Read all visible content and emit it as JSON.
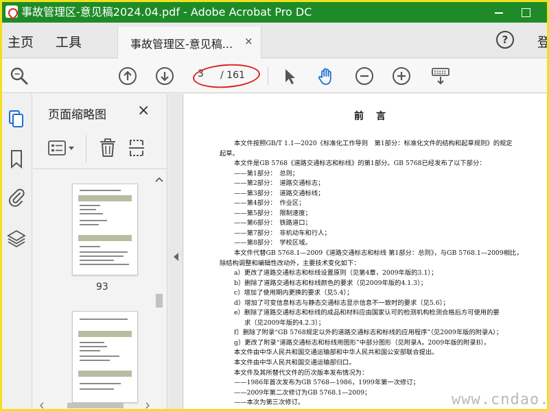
{
  "window": {
    "title": "事故管理区-意见稿2024.04.pdf - Adobe Acrobat Pro DC",
    "minimize_label": "",
    "maximize_label": ""
  },
  "menu": {
    "home": "主页",
    "tools": "工具",
    "tab_label": "事故管理区-意见稿...",
    "tab_close": "×",
    "help": "?",
    "login": "登"
  },
  "toolbar": {
    "current_page": "3",
    "total_pages": "/ 161"
  },
  "panel": {
    "title": "页面缩略图",
    "close": "×",
    "thumbnails": [
      {
        "label": "93"
      }
    ]
  },
  "document": {
    "heading": "前言",
    "lines": [
      {
        "cls": "i1",
        "text": "本文件按照GB/T 1.1—2020《标准化工作导则　第1部分：标准化文件的结构和起草规则》的规定"
      },
      {
        "cls": "",
        "text": "起草。"
      },
      {
        "cls": "i1",
        "text": "本文件是GB 5768《道路交通标志和标线》的第1部分。GB 5768已经发布了以下部分："
      },
      {
        "cls": "i2",
        "text": "——第1部分：　总则；"
      },
      {
        "cls": "i2",
        "text": "——第2部分：　道路交通标志；"
      },
      {
        "cls": "i2",
        "text": "——第3部分：　道路交通标线；"
      },
      {
        "cls": "i2",
        "text": "——第4部分：　作业区；"
      },
      {
        "cls": "i2",
        "text": "——第5部分：　限制速度；"
      },
      {
        "cls": "i2",
        "text": "——第6部分：　铁路道口；"
      },
      {
        "cls": "i2",
        "text": "——第7部分：　非机动车和行人；"
      },
      {
        "cls": "i2",
        "text": "——第8部分：　学校区域。"
      },
      {
        "cls": "i1",
        "text": "本文件代替GB 5768.1—2009《道路交通标志和标线 第1部分：总则》，与GB 5768.1—2009相比，"
      },
      {
        "cls": "",
        "text": "除结构调整和编辑性改动外，主要技术变化如下："
      },
      {
        "cls": "i2",
        "text": "a）更改了道路交通标志和标线设置原则（见第4章，2009年版的3.1）；"
      },
      {
        "cls": "i2",
        "text": "b）删除了道路交通标志和标线颜色的要求（见2009年版的4.1.3）；"
      },
      {
        "cls": "i2",
        "text": "c）增加了使用期内更换的要求（见5.4）；"
      },
      {
        "cls": "i2",
        "text": "d）增加了可变信息标志与静态交通标志显示信息不一致时的要求（见5.6）；"
      },
      {
        "cls": "i2",
        "text": "e）删除了道路交通标志和标线的成品和材料应由国家认可的检测机构检测合格后方可使用的要"
      },
      {
        "cls": "i3",
        "text": "求（见2009年版的4.2.3）；"
      },
      {
        "cls": "i2",
        "text": "f）删除了附录“GB 5768规定以外的道路交通标志和标线的应用程序”（见2009年版的附录A）；"
      },
      {
        "cls": "i2",
        "text": "g）更改了附录“道路交通标志和标线用图形”中部分图形（见附录A，2009年版的附录B）。"
      },
      {
        "cls": "i1",
        "text": "本文件由中华人民共和国交通运输部和中华人民共和国公安部联合提出。"
      },
      {
        "cls": "i1",
        "text": "本文件由中华人民共和国交通运输部归口。"
      },
      {
        "cls": "i1",
        "text": "本文件及其所替代文件的历次版本发布情况为："
      },
      {
        "cls": "i2",
        "text": "——1986年首次发布为GB 5768—1986，1999年第一次修订；"
      },
      {
        "cls": "i2",
        "text": "——2009年第二次修订为GB 5768.1—2009；"
      },
      {
        "cls": "i2",
        "text": "——本次为第三次修订。"
      }
    ],
    "watermark": "www.cndao.com"
  },
  "icons": {
    "zoom": "magnifier-icon",
    "prev": "arrow-up-circle-icon",
    "next": "arrow-down-circle-icon",
    "select": "cursor-icon",
    "hand": "hand-icon",
    "zoom_out": "minus-circle-icon",
    "zoom_in": "plus-circle-icon",
    "keyboard": "keyboard-icon"
  },
  "colors": {
    "titlebar": "#1e8b28",
    "accent": "#1a6fd6",
    "annotation": "#d9201d",
    "border": "#f2e01c"
  }
}
